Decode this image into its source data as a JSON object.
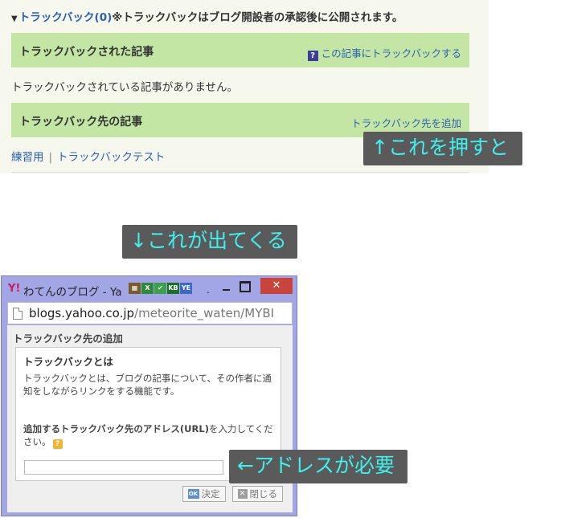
{
  "trackback_section": {
    "heading_link": "トラックバック",
    "heading_count": "(0)",
    "heading_note": "※トラックバックはブログ開設者の承認後に公開されます。",
    "received_title": "トラックバックされた記事",
    "received_link_icon": "?",
    "received_link": "この記事にトラックバックする",
    "no_trackbacks": "トラックバックされている記事がありません。",
    "sent_title": "トラックバック先の記事",
    "sent_link": "トラックバック先を追加",
    "sent_items": [
      "練習用",
      "トラックバックテスト"
    ],
    "separator": "|"
  },
  "annotations": {
    "press_this": "↑これを押すと",
    "this_appears": "↓これが出てくる",
    "address_needed": "←アドレスが必要"
  },
  "popup": {
    "logo_text": "Y!",
    "window_title": "わてんのブログ - Ya",
    "title_ellipsis": ".",
    "close_label": "✕",
    "ext_icons": [
      "calendar-icon",
      "excel-icon",
      "check-icon",
      "kb-icon",
      "ye-icon"
    ],
    "ext_labels": [
      "▦",
      "X",
      "✔",
      "KB",
      "YE"
    ],
    "url_domain": "blogs.yahoo.co.jp",
    "url_path": "/meteorite_waten/MYBI",
    "heading": "トラックバック先の追加",
    "help_title": "トラックバックとは",
    "help_desc": "トラックバックとは、ブログの記事について、その作者に通知をしながらリンクをする機能です。",
    "addr_label_bold": "追加するトラックバック先のアドレス(URL)",
    "addr_label_normal": "を入力してください。",
    "help_icon": "?",
    "ok_icon_text": "OK",
    "ok_button": "決定",
    "close_icon_text": "✕",
    "close_button": "閉じる",
    "url_value": ""
  },
  "colors": {
    "bar_green": "#c3e6a5",
    "link_blue": "#2a5fb4",
    "annotation_text": "#3ef0ee",
    "annotation_bg": "#5a5a5a",
    "window_frame": "#a3a6e4",
    "close_red": "#c7453a"
  }
}
